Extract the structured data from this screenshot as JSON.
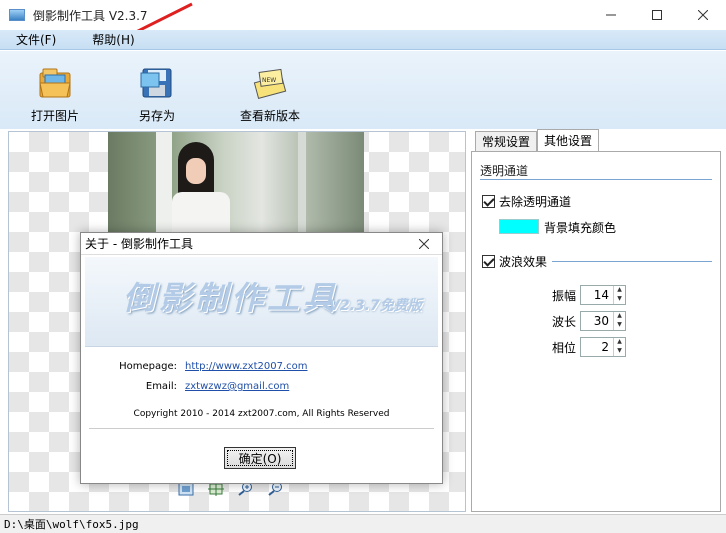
{
  "window": {
    "title": "倒影制作工具 V2.3.7"
  },
  "menu": {
    "file": "文件(F)",
    "help": "帮助(H)"
  },
  "toolbar": {
    "open": "打开图片",
    "save_as": "另存为",
    "check_update": "查看新版本"
  },
  "about_dialog": {
    "title": "关于 - 倒影制作工具",
    "banner_title": "倒影制作工具",
    "banner_version": "V2.3.7免费版",
    "homepage_label": "Homepage:",
    "homepage_value": "http://www.zxt2007.com",
    "email_label": "Email:",
    "email_value": "zxtwzwz@gmail.com",
    "copyright": "Copyright 2010 - 2014 zxt2007.com, All Rights Reserved",
    "ok_label": "确定(O)"
  },
  "settings": {
    "tabs": [
      "常规设置",
      "其他设置"
    ],
    "active_tab": 1,
    "transparent_section": "透明通道",
    "remove_alpha_label": "去除透明通道",
    "remove_alpha_checked": true,
    "bg_fill_label": "背景填充颜色",
    "bg_fill_color": "#00ffff",
    "wave_label": "波浪效果",
    "wave_checked": true,
    "amplitude_label": "振幅",
    "amplitude_value": "14",
    "wavelength_label": "波长",
    "wavelength_value": "30",
    "phase_label": "相位",
    "phase_value": "2"
  },
  "status": {
    "path": "D:\\桌面\\wolf\\fox5.jpg"
  },
  "icons": {
    "close": "close-icon",
    "minimize": "minimize-icon",
    "maximize": "maximize-icon"
  }
}
